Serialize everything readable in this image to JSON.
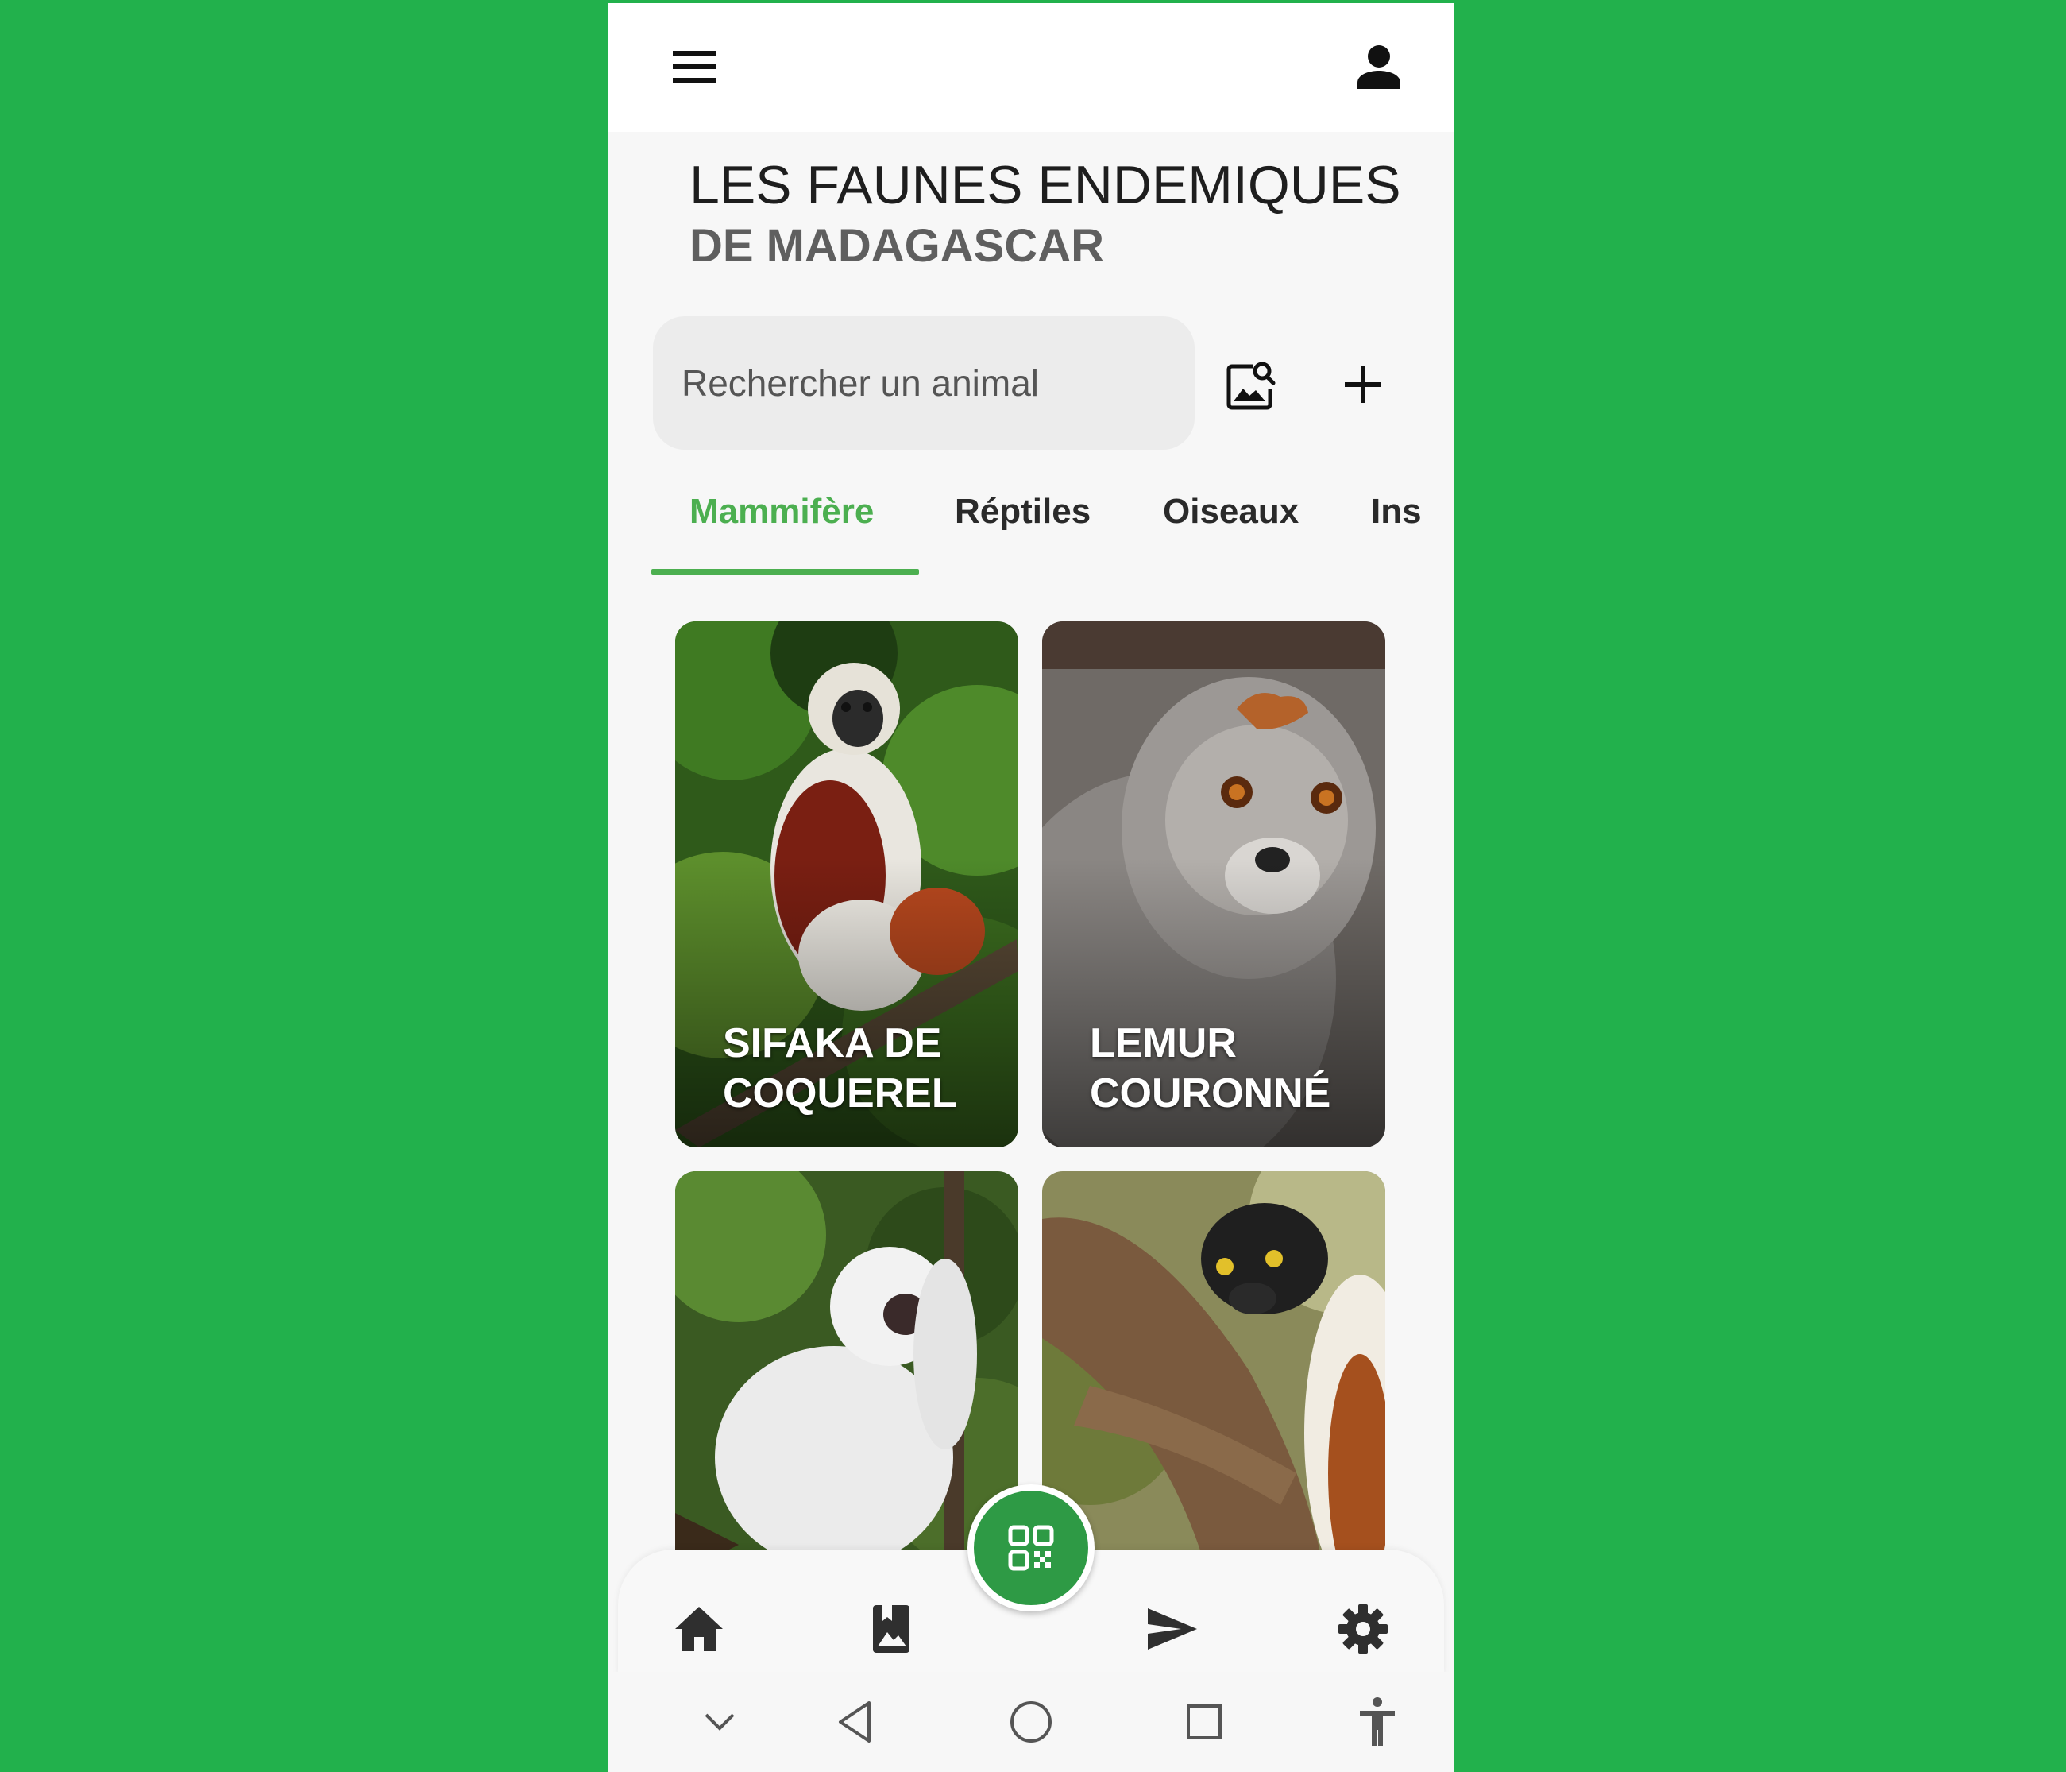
{
  "app": {
    "title_line1": "LES FAUNES ENDEMIQUES",
    "title_line2": "DE MADAGASCAR",
    "accent_color": "#4caf50",
    "fab_color": "#2e9a45",
    "background_color": "#22b14c"
  },
  "header": {
    "menu_icon": "hamburger-menu-icon",
    "profile_icon": "person-icon"
  },
  "search": {
    "placeholder": "Rechercher un animal",
    "image_search_icon": "image-search-icon",
    "add_icon": "plus-icon"
  },
  "tabs": [
    {
      "label": "Mammifère",
      "active": true
    },
    {
      "label": "Réptiles",
      "active": false
    },
    {
      "label": "Oiseaux",
      "active": false
    },
    {
      "label": "Ins",
      "active": false
    }
  ],
  "cards": [
    {
      "label": "SIFAKA DE COQUEREL"
    },
    {
      "label": "LEMUR COURONNÉ"
    },
    {
      "label": ""
    },
    {
      "label": ""
    }
  ],
  "bottom_nav": {
    "items": [
      "home-icon",
      "gallery-icon",
      "qr-code-icon",
      "send-icon",
      "settings-icon"
    ]
  },
  "system_bar": {
    "items": [
      "chevron-down-icon",
      "back-icon",
      "home-circle-icon",
      "recent-apps-icon",
      "accessibility-icon"
    ]
  }
}
